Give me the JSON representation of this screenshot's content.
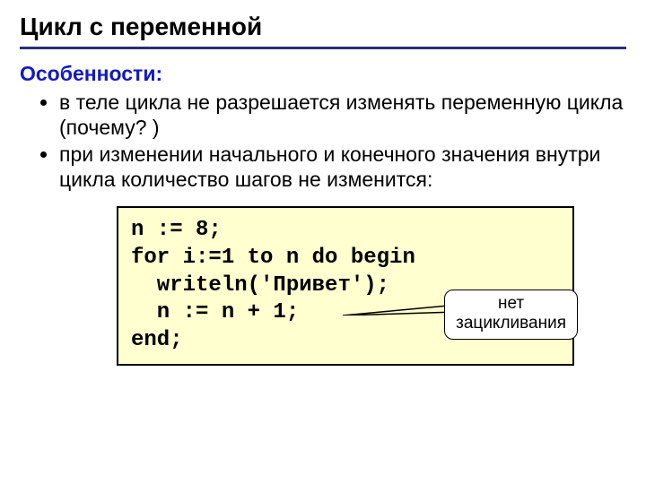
{
  "title": "Цикл с переменной",
  "subhead": "Особенности:",
  "bullets": [
    "в теле цикла не разрешается изменять переменную цикла (почему? )",
    "при изменении начального и конечного значения внутри цикла количество шагов не изменится:"
  ],
  "code": "n := 8;\nfor i:=1 to n do begin\n  writeln('Привет');\n  n := n + 1;\nend;",
  "callout": {
    "line1": "нет",
    "line2": "зацикливания"
  }
}
